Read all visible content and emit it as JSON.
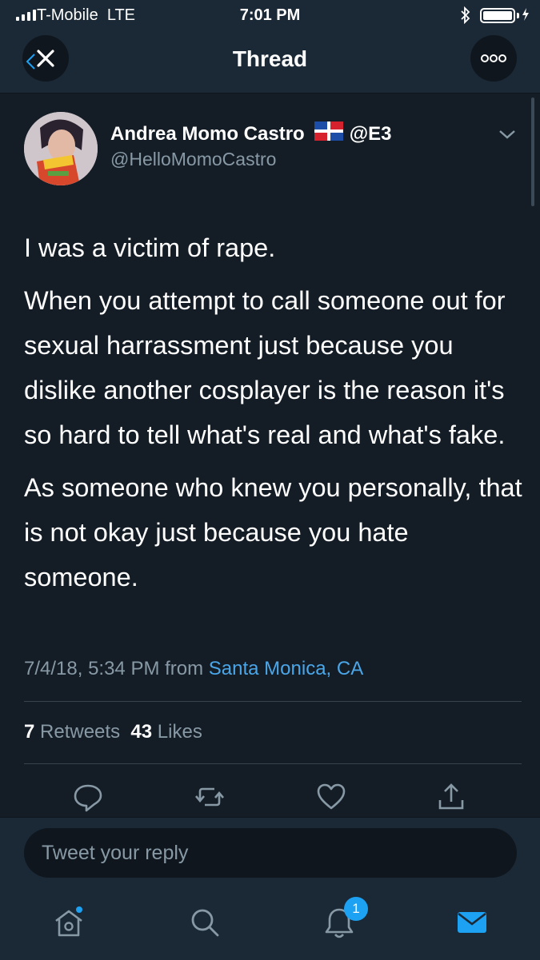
{
  "status_bar": {
    "carrier": "T-Mobile",
    "network": "LTE",
    "time": "7:01 PM"
  },
  "nav": {
    "title": "Thread",
    "close_icon": "close-x-icon",
    "more_icon": "more-dots-icon"
  },
  "tweet": {
    "author_name": "Andrea Momo Castro",
    "author_suffix": "@E3",
    "handle": "@HelloMomoCastro",
    "paragraphs": [
      "I was a victim of rape.",
      "When you attempt to call someone out for sexual harrassment just because you dislike another cosplayer is the reason it's so hard to tell what's real and what's fake.",
      "As someone who knew you personally, that is not okay just because you hate someone."
    ],
    "timestamp": "7/4/18, 5:34 PM from",
    "location": "Santa Monica, CA",
    "retweets_count": "7",
    "retweets_label": "Retweets",
    "likes_count": "43",
    "likes_label": "Likes"
  },
  "reply": {
    "placeholder": "Tweet your reply"
  },
  "tab_bar": {
    "notification_badge": "1",
    "active_color": "#1da1f2"
  },
  "colors": {
    "background": "#141d26",
    "bar": "#1b2836",
    "secondary_text": "#8899a6",
    "link": "#4aa6e9"
  }
}
